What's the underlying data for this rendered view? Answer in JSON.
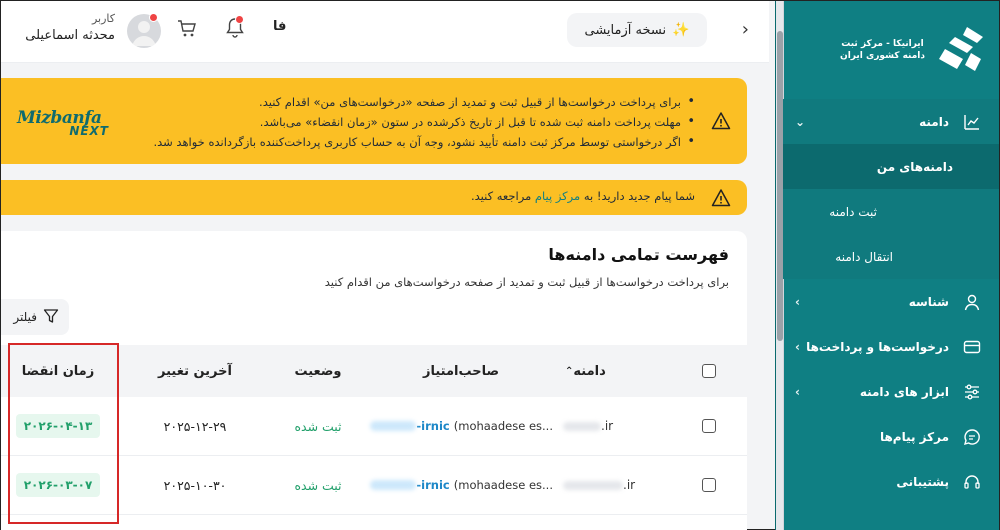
{
  "sidebar": {
    "logo_text": "ایرانیکا - مرکز ثبت\nدامنه کشوری ایران",
    "items": [
      {
        "label": "دامنه",
        "icon": "chart-icon",
        "expanded": true
      },
      {
        "label": "دامنه‌های من",
        "selected": true
      },
      {
        "label": "ثبت دامنه"
      },
      {
        "label": "انتقال دامنه"
      },
      {
        "label": "شناسه",
        "icon": "user-icon"
      },
      {
        "label": "درخواست‌ها و پرداخت‌ها",
        "icon": "card-icon"
      },
      {
        "label": "ابزار های دامنه",
        "icon": "sliders-icon"
      },
      {
        "label": "مرکز پیام‌ها",
        "icon": "chat-icon"
      },
      {
        "label": "پشتیبانی",
        "icon": "headset-icon"
      }
    ]
  },
  "topbar": {
    "demo_label": "نسخه آزمایشی",
    "lang": "فا",
    "user_role": "کاربر",
    "user_name": "محدثه اسماعیلی"
  },
  "alert1": {
    "items": [
      "برای پرداخت درخواست‌ها از قبیل ثبت و تمدید از صفحه «درخواست‌های من» اقدام کنید.",
      "مهلت پرداخت دامنه ثبت شده تا قبل از تاریخ ذکرشده در ستون «زمان انقضاء» می‌باشد.",
      "اگر درخواستی توسط مرکز ثبت دامنه تأیید نشود، وجه آن به حساب کاربری پرداخت‌کننده بازگردانده خواهد شد."
    ],
    "brand_top": "Mizbanfa",
    "brand_bottom": "NEXT"
  },
  "alert2": {
    "prefix": "شما پیام جدید دارید! به",
    "link": "مرکز پیام",
    "suffix": "مراجعه کنید."
  },
  "list": {
    "title": "فهرست تمامی دامنه‌ها",
    "subtitle": "برای پرداخت درخواست‌ها از قبیل ثبت و تمدید از صفحه درخواست‌های من اقدام کنید",
    "filter_label": "فیلتر",
    "columns": {
      "domain": "دامنه",
      "owner": "صاحب‌امتیاز",
      "status": "وضعیت",
      "last_change": "آخرین تغییر",
      "expire": "زمان انقضا"
    },
    "rows": [
      {
        "tld": ".ir",
        "owner_handle": "-irnic",
        "owner_name": "(mohaadese es...",
        "status": "ثبت شده",
        "last_change": "۲۰۲۵-۱۲-۲۹",
        "expire": "۲۰۲۶-۰۴-۱۳"
      },
      {
        "tld": ".ir",
        "owner_handle": "-irnic",
        "owner_name": "(mohaadese es...",
        "status": "ثبت شده",
        "last_change": "۲۰۲۵-۱۰-۳۰",
        "expire": "۲۰۲۶-۰۳-۰۷"
      }
    ]
  }
}
